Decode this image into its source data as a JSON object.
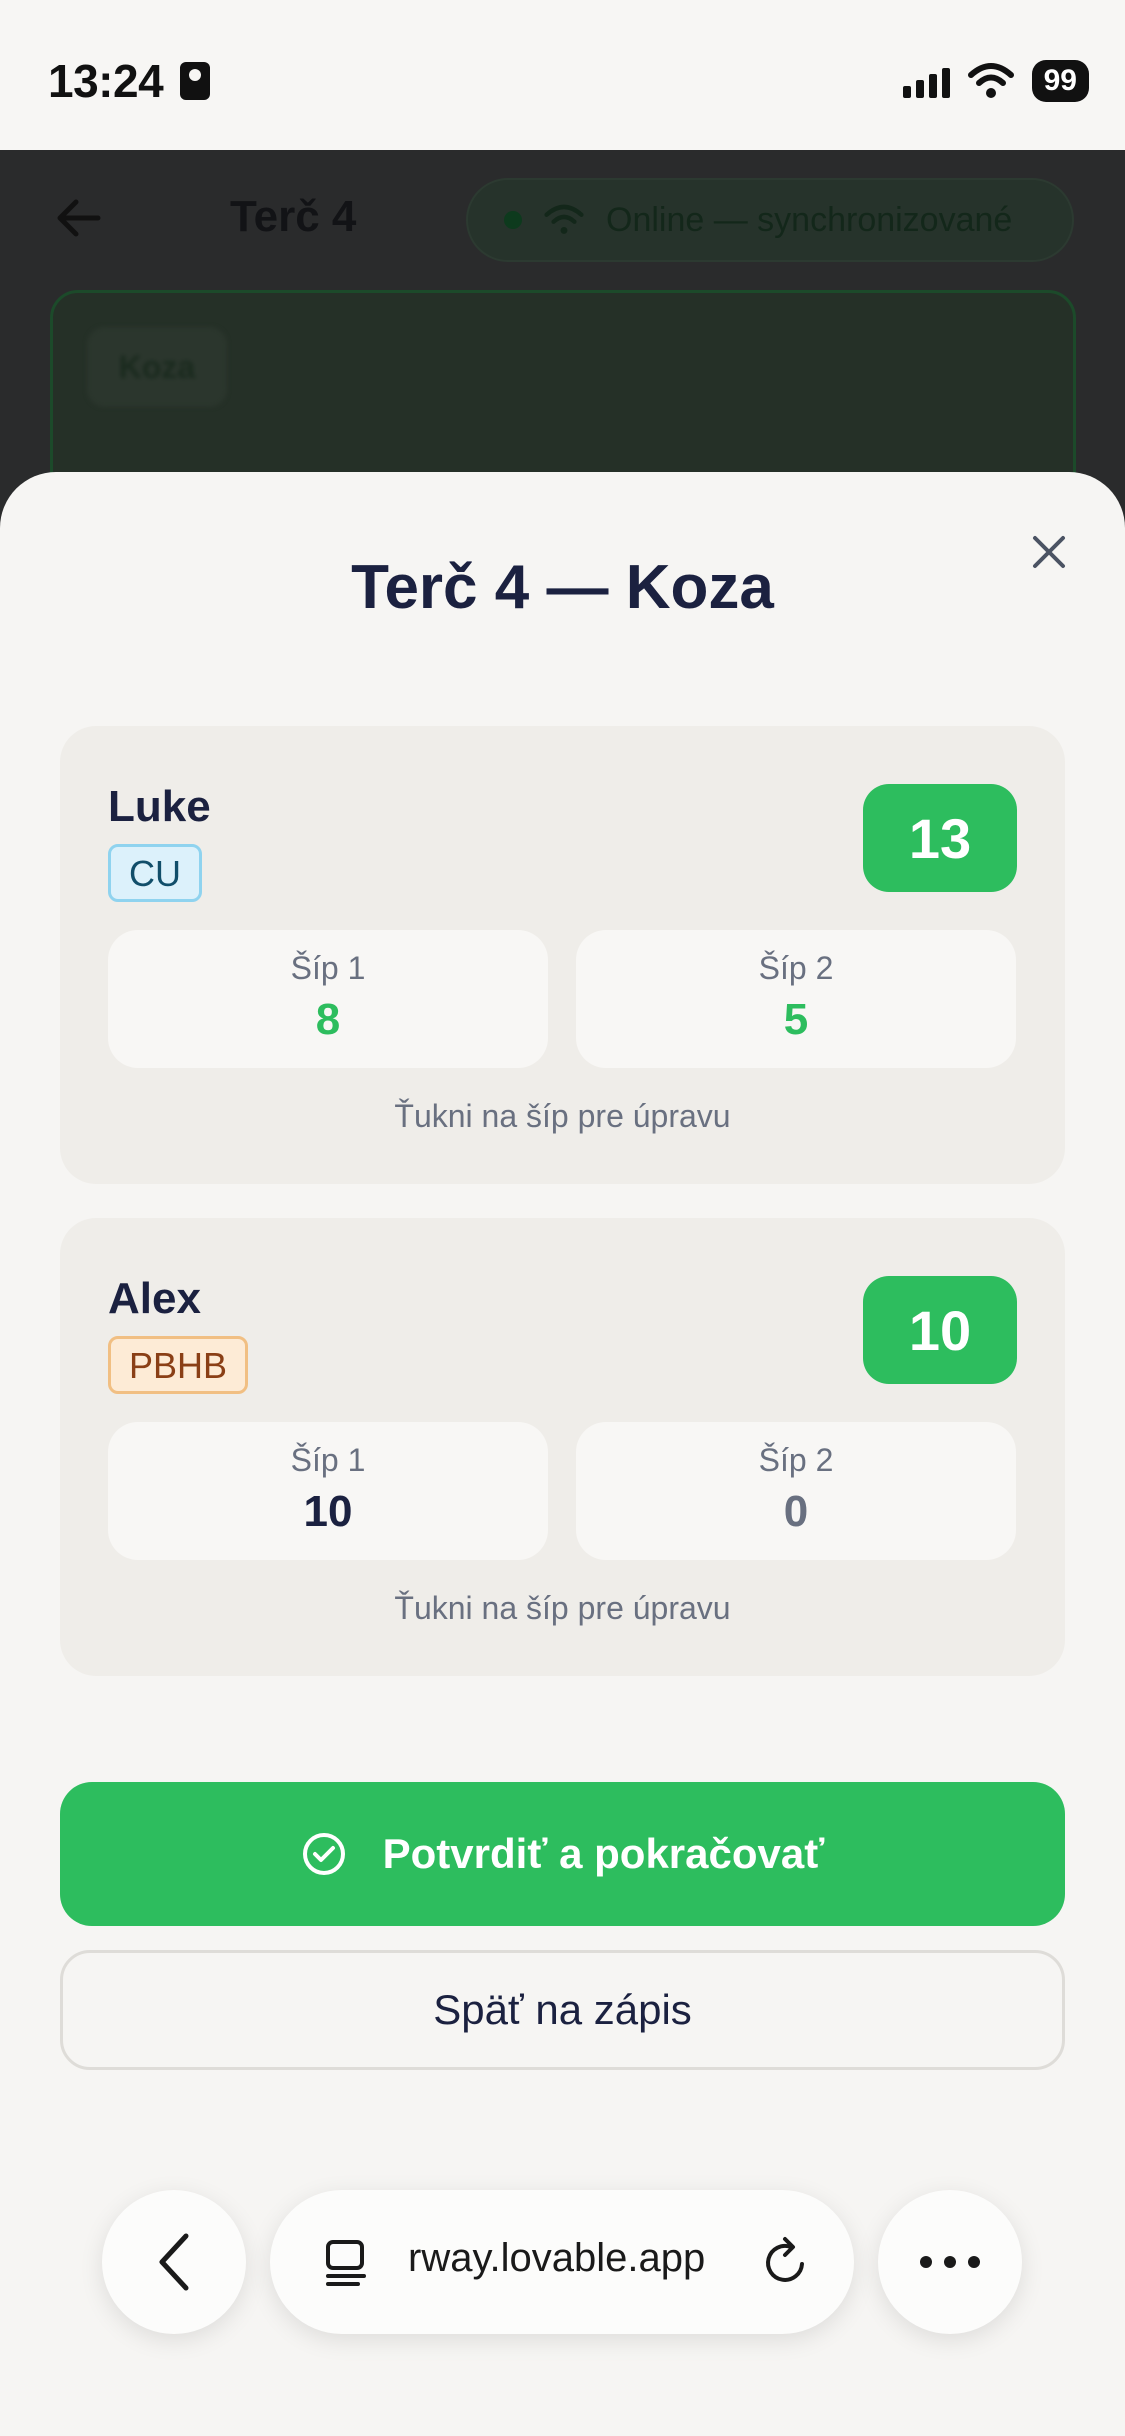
{
  "status_bar": {
    "time": "13:24",
    "battery": "99"
  },
  "background": {
    "title": "Terč 4",
    "online_status": "Online — synchronizované",
    "target_chip": "Koza"
  },
  "sheet": {
    "title": "Terč 4 — Koza",
    "players": [
      {
        "name": "Luke",
        "category": "CU",
        "total": "13",
        "arrows": [
          {
            "label": "Šíp 1",
            "value": "8"
          },
          {
            "label": "Šíp 2",
            "value": "5"
          }
        ],
        "hint": "Ťukni na šíp pre úpravu"
      },
      {
        "name": "Alex",
        "category": "PBHB",
        "total": "10",
        "arrows": [
          {
            "label": "Šíp 1",
            "value": "10"
          },
          {
            "label": "Šíp 2",
            "value": "0"
          }
        ],
        "hint": "Ťukni na šíp pre úpravu"
      }
    ],
    "confirm_label": "Potvrdiť a pokračovať",
    "back_label": "Späť na zápis"
  },
  "browser": {
    "url": "rway.lovable.app"
  },
  "colors": {
    "accent": "#2dbd5e",
    "text": "#1b2140",
    "muted": "#697080"
  }
}
